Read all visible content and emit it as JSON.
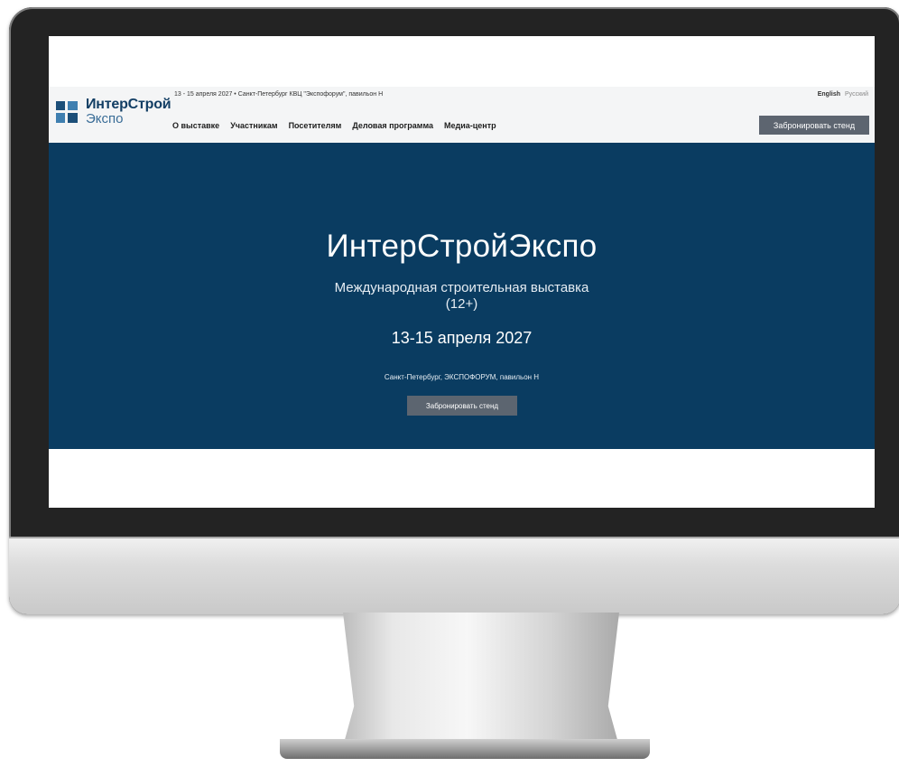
{
  "header": {
    "logo": {
      "line1": "ИнтерСтрой",
      "line2": "Экспо"
    },
    "topline": "13 - 15 апреля 2027 • Санкт-Петербург КВЦ \"Экспофорум\", павильон Н",
    "lang": {
      "english": "English",
      "russian": "Русский"
    },
    "nav": [
      {
        "label": "О выставке"
      },
      {
        "label": "Участникам"
      },
      {
        "label": "Посетителям"
      },
      {
        "label": "Деловая программа"
      },
      {
        "label": "Медиа-центр"
      }
    ],
    "book_button": "Забронировать стенд"
  },
  "hero": {
    "title": "ИнтерСтройЭкспо",
    "subtitle": "Международная строительная выставка",
    "age_rating": "(12+)",
    "dates": "13-15 апреля 2027",
    "location": "Санкт-Петербург, ЭКСПОФОРУМ, павильон Н",
    "book_button": "Забронировать стенд"
  },
  "colors": {
    "hero_background": "#0a3c61",
    "button_background": "#5d6570",
    "brand_dark": "#123e64",
    "brand_light": "#3a6d97"
  }
}
